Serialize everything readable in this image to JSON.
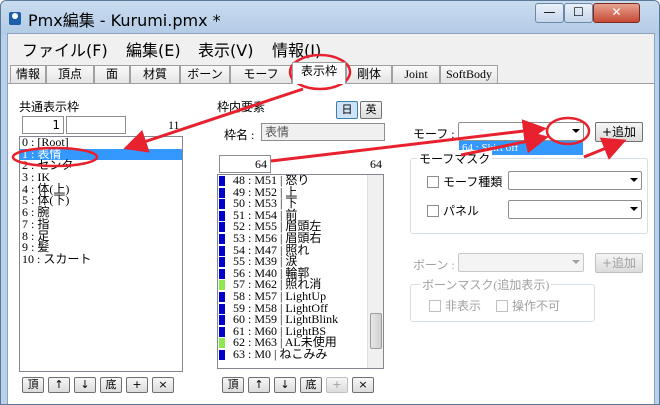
{
  "window": {
    "title": "Pmx編集 - Kurumi.pmx *",
    "min": "—",
    "max": "☐",
    "close": "✕"
  },
  "menu": [
    "ファイル(F)",
    "編集(E)",
    "表示(V)",
    "情報(I)"
  ],
  "tabs": [
    "情報",
    "頂点",
    "面",
    "材質",
    "ボーン",
    "モーフ",
    "表示枠",
    "剛体",
    "Joint",
    "SoftBody"
  ],
  "left": {
    "header": "共通表示枠",
    "index_value": "1",
    "name_value": "",
    "count": "11",
    "items": [
      "0 : [Root]",
      "1 : 表情",
      "2 : センター",
      "3 : IK",
      "4 : 体(上)",
      "5 : 体(下)",
      "6 : 腕",
      "7 : 指",
      "8 : 足",
      "9 : 髪",
      "10 : スカート"
    ],
    "buttons": [
      "頂",
      "↑",
      "↓",
      "底",
      "+",
      "×"
    ]
  },
  "middle": {
    "header": "枠内要素",
    "lang_jp": "日",
    "lang_en": "英",
    "name_label": "枠名 :",
    "name_value": "表情",
    "count_left": "64",
    "count_right": "64",
    "rows": [
      {
        "t": "48 : M51 | 怒り",
        "c": "#0000c8"
      },
      {
        "t": "49 : M52 | 上",
        "c": "#0000c8"
      },
      {
        "t": "50 : M53 | 下",
        "c": "#0000c8"
      },
      {
        "t": "51 : M54 | 前",
        "c": "#0000c8"
      },
      {
        "t": "52 : M55 | 眉頭左",
        "c": "#0000c8"
      },
      {
        "t": "53 : M56 | 眉頭右",
        "c": "#0000c8"
      },
      {
        "t": "54 : M47 | 照れ",
        "c": "#0000c8"
      },
      {
        "t": "55 : M39 | 涙",
        "c": "#0000c8"
      },
      {
        "t": "56 : M40 | 輪郭",
        "c": "#0000c8"
      },
      {
        "t": "57 : M62 | 照れ消",
        "c": "#8ee850"
      },
      {
        "t": "58 : M57 | LightUp",
        "c": "#0000c8"
      },
      {
        "t": "59 : M58 | LightOff",
        "c": "#0000c8"
      },
      {
        "t": "60 : M59 | LightBlink",
        "c": "#0000c8"
      },
      {
        "t": "61 : M60 | LightBS",
        "c": "#0000c8"
      },
      {
        "t": "62 : M63 | AL未使用",
        "c": "#8ee850"
      },
      {
        "t": "63 : M0 | ねこみみ",
        "c": "#0000c8"
      }
    ],
    "buttons": [
      "頂",
      "↑",
      "↓",
      "底",
      "+",
      "×"
    ]
  },
  "right": {
    "morph_label": "モーフ :",
    "morph_selected": "64 : Skirt off",
    "add_button": "+追加",
    "morph_mask": "モーフマスク",
    "morph_type": "モーフ種類",
    "panel": "パネル",
    "bone_label": "ボーン :",
    "bone_add": "+追加",
    "bone_mask": "ボーンマスク(追加表示)",
    "hidden": "非表示",
    "no_op": "操作不可"
  },
  "colors": {
    "accent": "#3399ff",
    "annotation": "#e8212e"
  }
}
